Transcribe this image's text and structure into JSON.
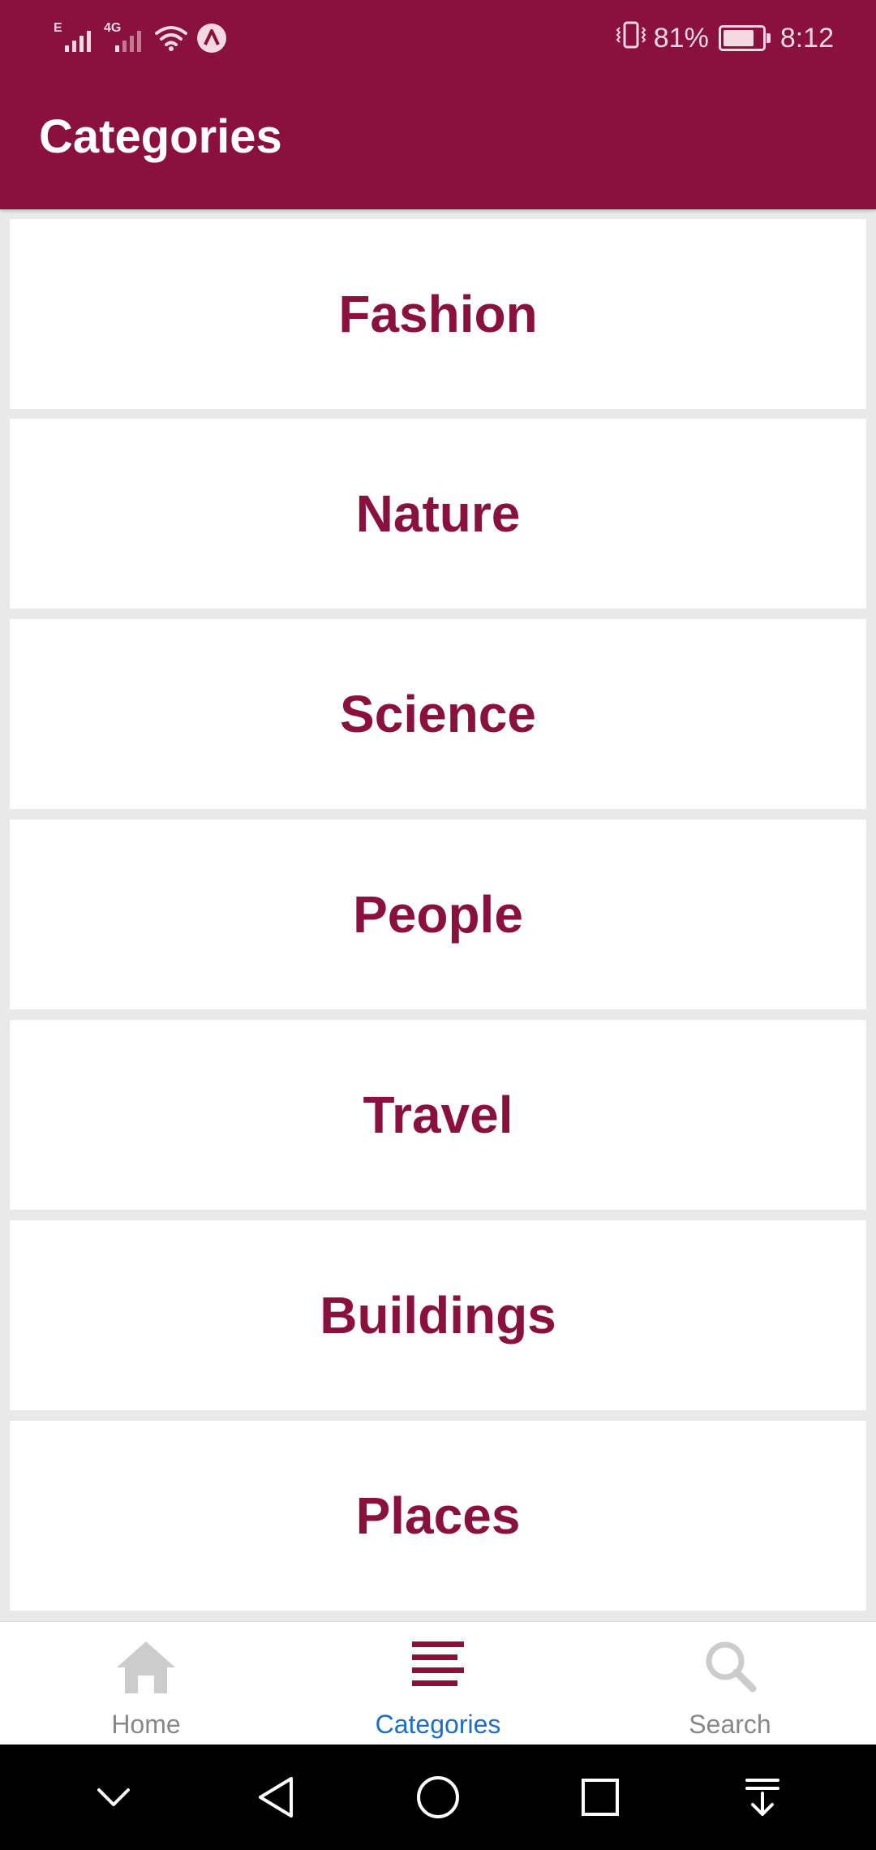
{
  "status_bar": {
    "signal_1_tag": "E",
    "signal_2_tag": "4G",
    "battery_percent": "81%",
    "time": "8:12",
    "battery_level": 0.81,
    "icons": [
      "signal-icon",
      "signal-4g-icon",
      "wifi-icon",
      "vpn-icon",
      "vibrate-icon",
      "battery-icon"
    ]
  },
  "app_bar": {
    "title": "Categories"
  },
  "categories": {
    "items": [
      {
        "label": "Fashion"
      },
      {
        "label": "Nature"
      },
      {
        "label": "Science"
      },
      {
        "label": "People"
      },
      {
        "label": "Travel"
      },
      {
        "label": "Buildings"
      },
      {
        "label": "Places"
      }
    ]
  },
  "bottom_nav": {
    "items": [
      {
        "label": "Home",
        "icon": "home-icon",
        "active": false
      },
      {
        "label": "Categories",
        "icon": "list-icon",
        "active": true
      },
      {
        "label": "Search",
        "icon": "search-icon",
        "active": false
      }
    ]
  },
  "system_nav": {
    "icons": [
      "chevron-down-icon",
      "back-icon",
      "home-circle-icon",
      "recents-icon",
      "notifications-pull-icon"
    ]
  },
  "colors": {
    "brand": "#8a103e",
    "active_tab": "#1b6fc9",
    "inactive_tab": "#888888",
    "inactive_icon": "#cccccc",
    "list_background": "#e9e9e9"
  }
}
